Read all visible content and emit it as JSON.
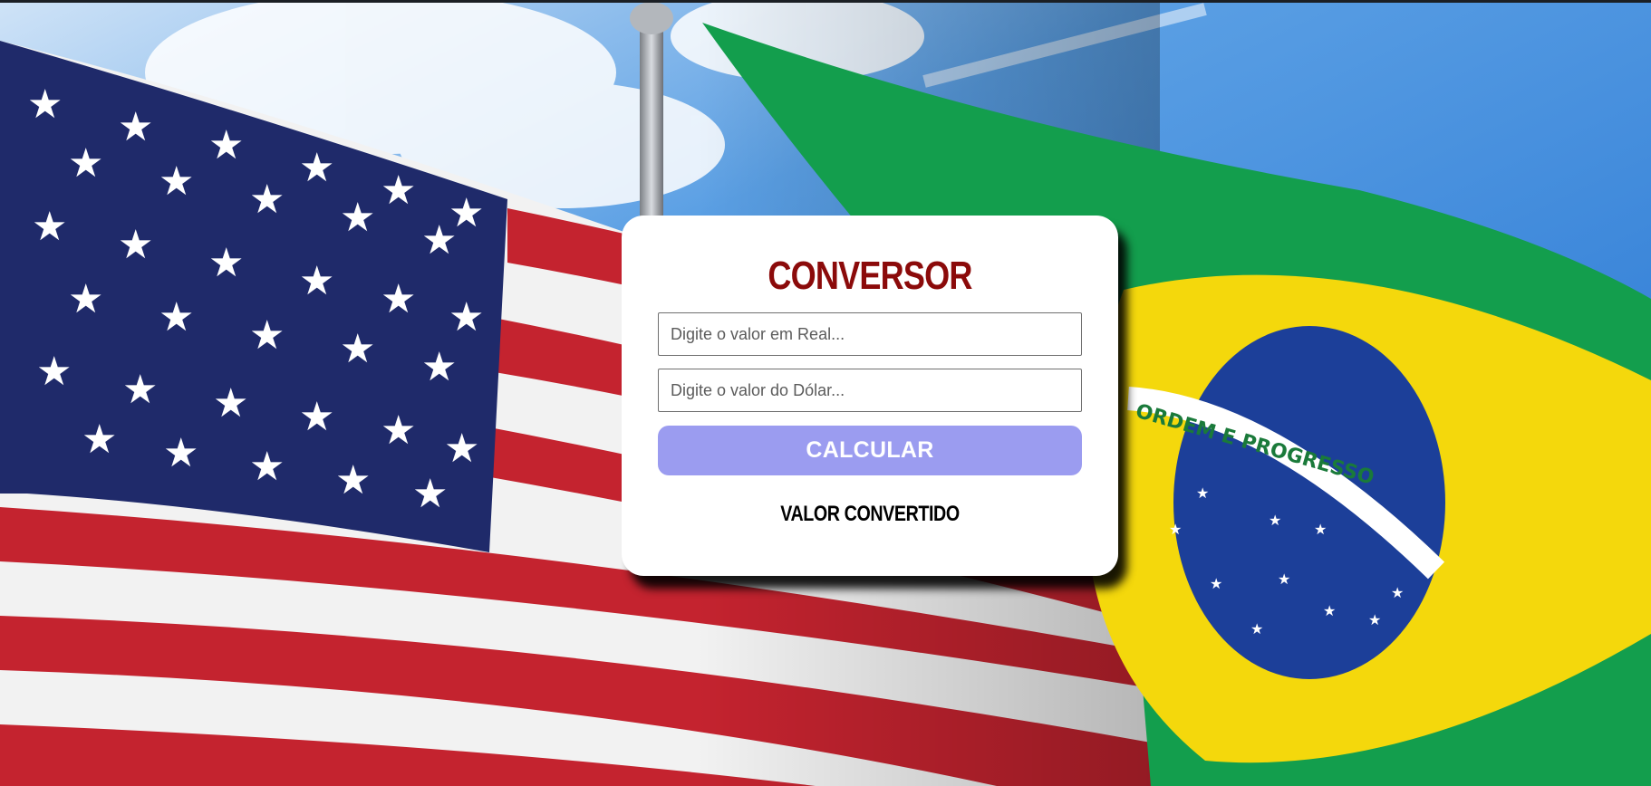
{
  "background": {
    "left_flag": "us-flag",
    "right_flag": "brazil-flag",
    "brazil_motto": "ORDEM E PROGRESSO",
    "sky_color": "#2a7fd6"
  },
  "converter": {
    "title": "CONVERSOR",
    "title_color": "#8b0a0a",
    "real_field": {
      "value": "",
      "placeholder": "Digite o valor em Real..."
    },
    "dolar_field": {
      "value": "",
      "placeholder": "Digite o valor do Dólar..."
    },
    "calculate_label": "CALCULAR",
    "button_color": "#9b9cf0",
    "result_label": "VALOR CONVERTIDO"
  }
}
